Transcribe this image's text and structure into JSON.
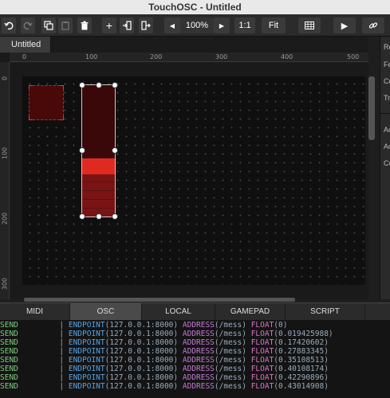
{
  "window": {
    "title": "TouchOSC - Untitled"
  },
  "toolbar": {
    "zoom": "100%",
    "ratio_label": "1:1",
    "fit_label": "Fit"
  },
  "tabs": [
    {
      "label": "Untitled"
    }
  ],
  "ruler": {
    "top": [
      "0",
      "100",
      "200",
      "300",
      "400",
      "500"
    ],
    "left": [
      "0",
      "100",
      "200",
      "300"
    ]
  },
  "right_panel": {
    "letters": [
      "Re",
      "Fe",
      "Co",
      "Tr",
      "Ac",
      "Ac",
      "Co"
    ]
  },
  "bottom_tabs": [
    {
      "label": "MIDI"
    },
    {
      "label": "OSC",
      "active": true
    },
    {
      "label": "LOCAL"
    },
    {
      "label": "GAMEPAD"
    },
    {
      "label": "SCRIPT"
    }
  ],
  "fader": {
    "value": 0.43014908
  },
  "colors": {
    "accent": "#e02a20",
    "canvas_bg": "#0f0f0f"
  },
  "log": {
    "rows": [
      {
        "dir": "SEND",
        "sep": "|",
        "ep": "ENDPOINT",
        "ep_value": "(127.0.0.1:8000)",
        "addr": "ADDRESS",
        "addr_value": "(/mess)",
        "type": "FLOAT",
        "value": "(0)"
      },
      {
        "dir": "SEND",
        "sep": "|",
        "ep": "ENDPOINT",
        "ep_value": "(127.0.0.1:8000)",
        "addr": "ADDRESS",
        "addr_value": "(/mess)",
        "type": "FLOAT",
        "value": "(0.019425988)"
      },
      {
        "dir": "SEND",
        "sep": "|",
        "ep": "ENDPOINT",
        "ep_value": "(127.0.0.1:8000)",
        "addr": "ADDRESS",
        "addr_value": "(/mess)",
        "type": "FLOAT",
        "value": "(0.17420602)"
      },
      {
        "dir": "SEND",
        "sep": "|",
        "ep": "ENDPOINT",
        "ep_value": "(127.0.0.1:8000)",
        "addr": "ADDRESS",
        "addr_value": "(/mess)",
        "type": "FLOAT",
        "value": "(0.27883345)"
      },
      {
        "dir": "SEND",
        "sep": "|",
        "ep": "ENDPOINT",
        "ep_value": "(127.0.0.1:8000)",
        "addr": "ADDRESS",
        "addr_value": "(/mess)",
        "type": "FLOAT",
        "value": "(0.35108513)"
      },
      {
        "dir": "SEND",
        "sep": "|",
        "ep": "ENDPOINT",
        "ep_value": "(127.0.0.1:8000)",
        "addr": "ADDRESS",
        "addr_value": "(/mess)",
        "type": "FLOAT",
        "value": "(0.40108174)"
      },
      {
        "dir": "SEND",
        "sep": "|",
        "ep": "ENDPOINT",
        "ep_value": "(127.0.0.1:8000)",
        "addr": "ADDRESS",
        "addr_value": "(/mess)",
        "type": "FLOAT",
        "value": "(0.42290896)"
      },
      {
        "dir": "SEND",
        "sep": "|",
        "ep": "ENDPOINT",
        "ep_value": "(127.0.0.1:8000)",
        "addr": "ADDRESS",
        "addr_value": "(/mess)",
        "type": "FLOAT",
        "value": "(0.43014908)"
      }
    ]
  }
}
